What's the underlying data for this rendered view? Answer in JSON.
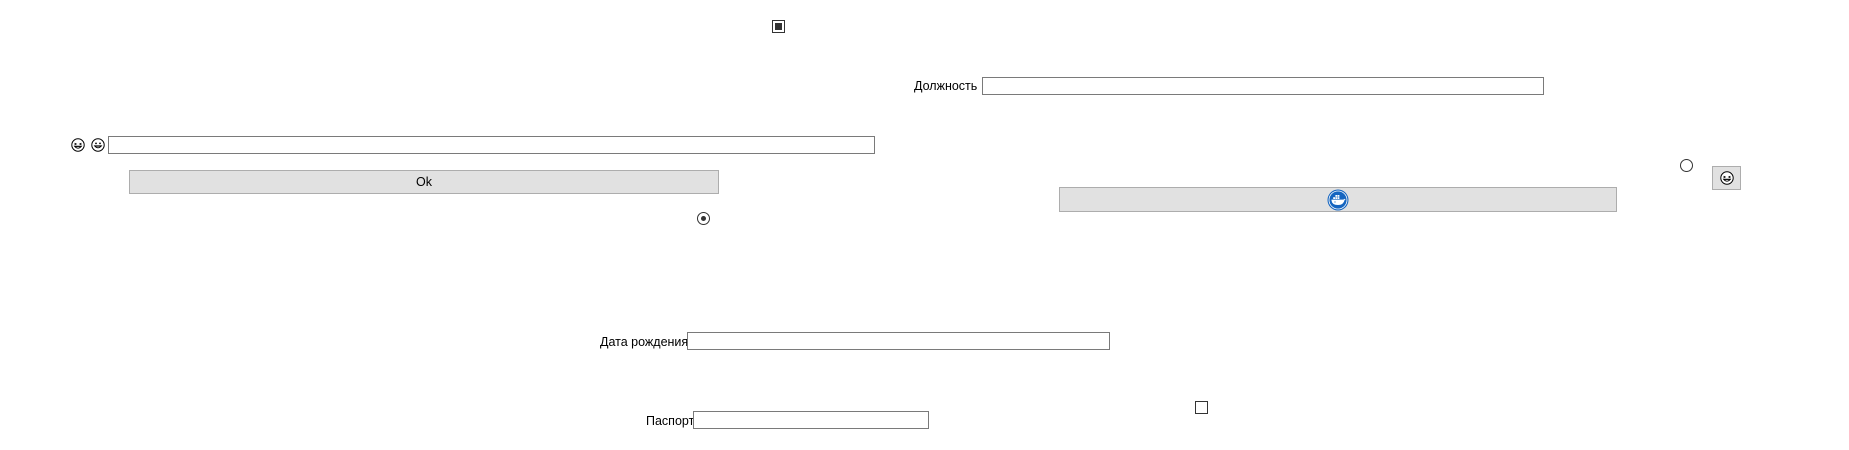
{
  "window": {
    "background": "#ffffff"
  },
  "form": {
    "position_label": "Должность",
    "position_value": "",
    "birthdate_label": "Дата рождения",
    "birthdate_value": "",
    "passport_label": "Паспорт",
    "passport_value": "",
    "emoji_field_value": ""
  },
  "buttons": {
    "ok_label": "Ok",
    "whale_button_icon": "docker-whale-icon",
    "emoji_button_icon": "grinning-squint-face-icon"
  },
  "checkboxes": {
    "top_checkbox_state": "indeterminate",
    "bottom_checkbox_state": "unchecked"
  },
  "radios": {
    "radio_left_checked": true,
    "radio_right_checked": false
  },
  "icons": {
    "emoji_1": "grinning-squint-face-icon",
    "emoji_2": "grinning-face-icon"
  },
  "colors": {
    "button_bg": "#e1e1e1",
    "button_border": "#adadad",
    "textbox_border": "#7a7a7a",
    "whale_blue": "#1565c0"
  }
}
